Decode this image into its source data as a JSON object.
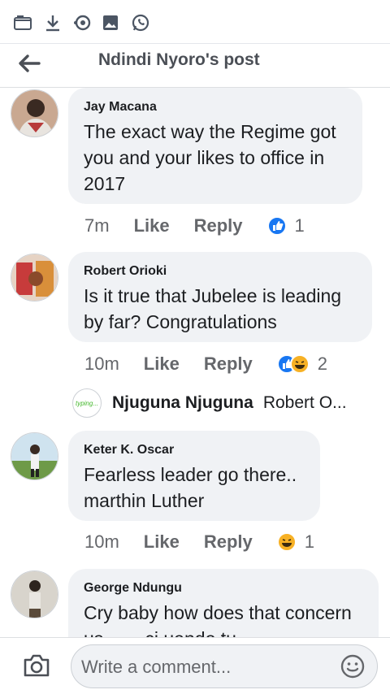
{
  "statusbar": {
    "icons": [
      "folder-clock-icon",
      "download-icon",
      "sync-icon",
      "image-icon",
      "whatsapp-icon"
    ]
  },
  "header": {
    "title": "Ndindi Nyoro's post",
    "back_icon": "back-arrow-icon"
  },
  "comments": [
    {
      "author": "Jay Macana",
      "text_lines": [
        "The exact way the Regime got",
        "you and your likes to office in",
        "2017"
      ],
      "time": "7m",
      "like_label": "Like",
      "reply_label": "Reply",
      "reactions": [
        "like"
      ],
      "reaction_count": "1"
    },
    {
      "author": "Robert Orioki",
      "text_lines": [
        "Is it true that Jubelee is leading",
        "by far? Congratulations"
      ],
      "time": "10m",
      "like_label": "Like",
      "reply_label": "Reply",
      "reactions": [
        "like",
        "haha"
      ],
      "reaction_count": "2"
    },
    {
      "author": "Keter K. Oscar",
      "text_lines": [
        "Fearless leader go there..",
        "marthin Luther"
      ],
      "time": "10m",
      "like_label": "Like",
      "reply_label": "Reply",
      "reactions": [
        "haha"
      ],
      "reaction_count": "1"
    },
    {
      "author": "George Ndungu",
      "text_lines": [
        "Cry baby how does that concern",
        "us ...... ci uando tu"
      ]
    }
  ],
  "reply_preview": {
    "icon_text": "typing...",
    "name": "Njuguna Njuguna",
    "snippet": "Robert O..."
  },
  "composer": {
    "placeholder": "Write a comment...",
    "camera_icon": "camera-icon",
    "emoji_icon": "emoji-icon"
  },
  "colors": {
    "bubble": "#f0f2f5",
    "like_blue": "#1877f2",
    "haha_yellow": "#f7b125",
    "meta_gray": "#65676b"
  }
}
